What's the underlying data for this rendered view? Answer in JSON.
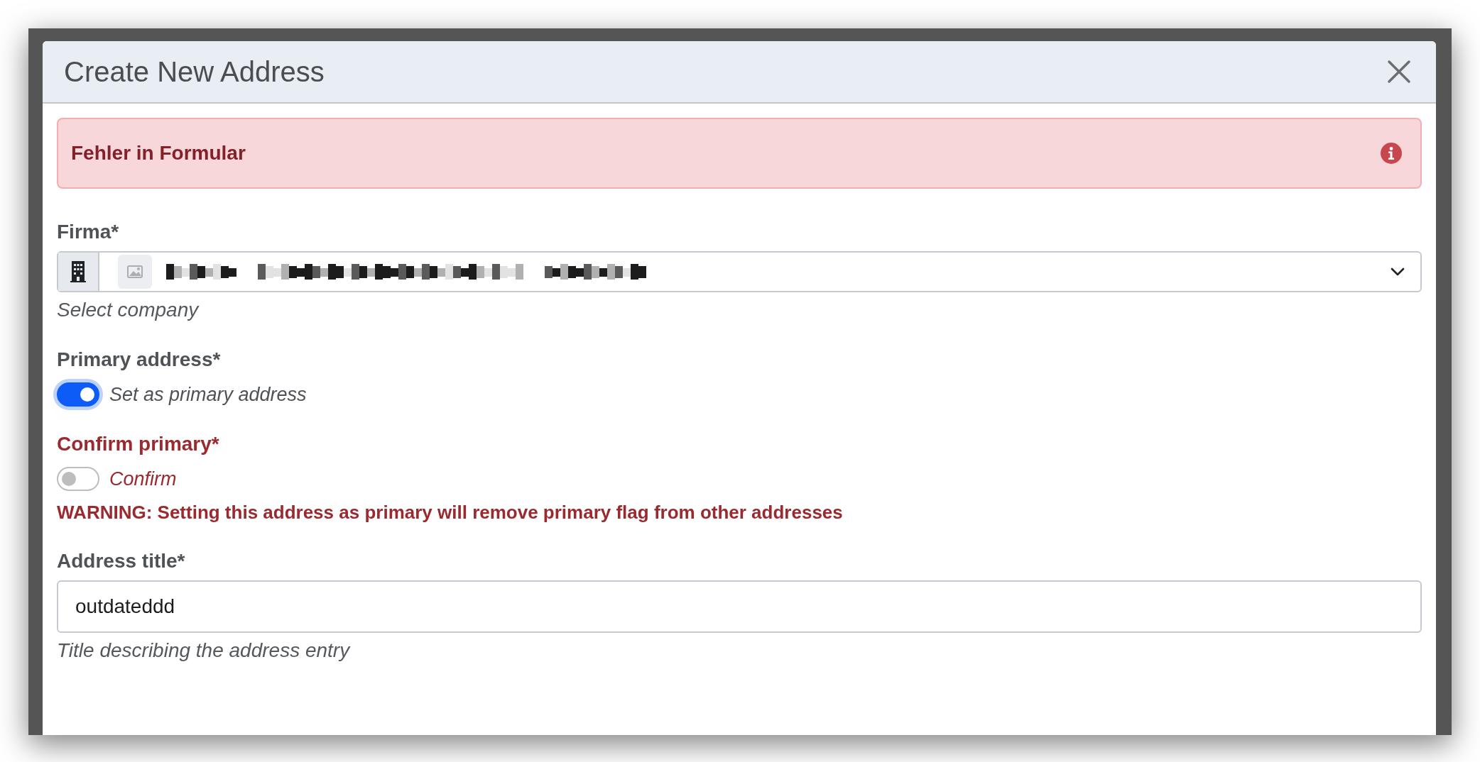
{
  "dialog": {
    "title": "Create New Address"
  },
  "alert": {
    "text": "Fehler in Formular"
  },
  "fields": [
    {
      "kind": "select",
      "label": "Firma*",
      "invalid": false,
      "help": "Select company"
    },
    {
      "kind": "switch",
      "label": "Primary address*",
      "on": true,
      "switch_label": "Set as primary address",
      "invalid": false
    },
    {
      "kind": "switch",
      "label": "Confirm primary*",
      "on": false,
      "switch_label": "Confirm",
      "invalid": true,
      "warning": "WARNING: Setting this address as primary will remove primary flag from other addresses"
    },
    {
      "kind": "text",
      "label": "Address title*",
      "value": "outdateddd",
      "help": "Title describing the address entry",
      "invalid": false
    }
  ]
}
